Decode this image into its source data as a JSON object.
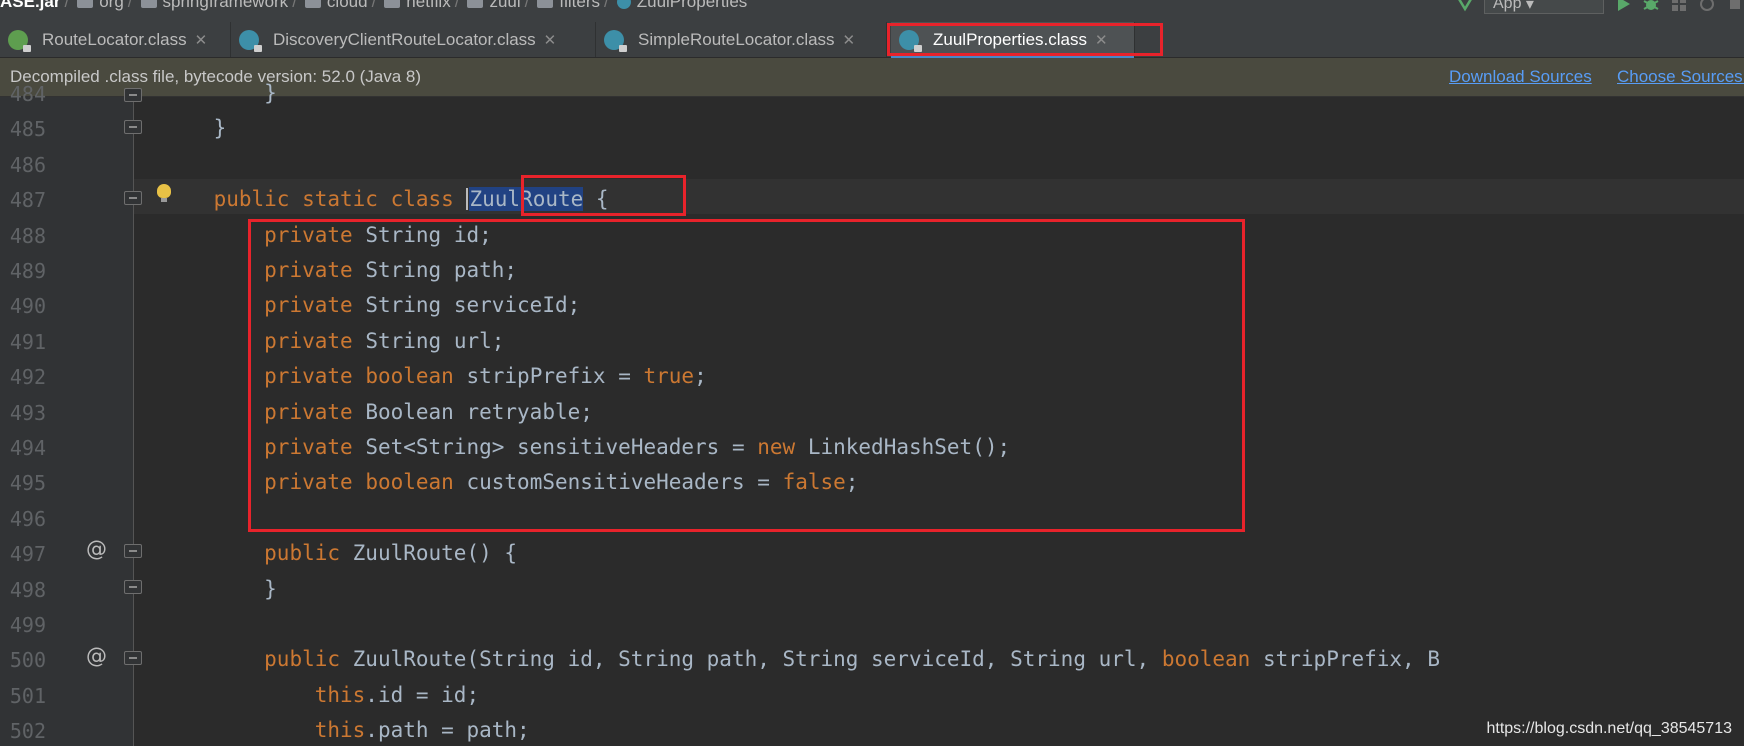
{
  "breadcrumb": [
    "ASE.jar",
    "org",
    "springframework",
    "cloud",
    "netflix",
    "zuul",
    "filters",
    "ZuulProperties"
  ],
  "toolbar": {
    "run_config": "App"
  },
  "tabs": [
    {
      "label": "RouteLocator.class",
      "icon": "interface-icon"
    },
    {
      "label": "DiscoveryClientRouteLocator.class",
      "icon": "class-icon"
    },
    {
      "label": "SimpleRouteLocator.class",
      "icon": "class-icon"
    },
    {
      "label": "ZuulProperties.class",
      "icon": "class-icon",
      "active": true
    }
  ],
  "infobar": {
    "message": "Decompiled .class file, bytecode version: 52.0 (Java 8)",
    "download_sources": "Download Sources",
    "choose_sources": "Choose Sources..."
  },
  "editor": {
    "lines": [
      {
        "n": "484",
        "text": "        }"
      },
      {
        "n": "485",
        "text": "    }"
      },
      {
        "n": "486",
        "text": ""
      },
      {
        "n": "487",
        "text": "    public static class ZuulRoute {"
      },
      {
        "n": "488",
        "text": "        private String id;"
      },
      {
        "n": "489",
        "text": "        private String path;"
      },
      {
        "n": "490",
        "text": "        private String serviceId;"
      },
      {
        "n": "491",
        "text": "        private String url;"
      },
      {
        "n": "492",
        "text": "        private boolean stripPrefix = true;"
      },
      {
        "n": "493",
        "text": "        private Boolean retryable;"
      },
      {
        "n": "494",
        "text": "        private Set<String> sensitiveHeaders = new LinkedHashSet();"
      },
      {
        "n": "495",
        "text": "        private boolean customSensitiveHeaders = false;"
      },
      {
        "n": "496",
        "text": ""
      },
      {
        "n": "497",
        "text": "        public ZuulRoute() {"
      },
      {
        "n": "498",
        "text": "        }"
      },
      {
        "n": "499",
        "text": ""
      },
      {
        "n": "500",
        "text": "        public ZuulRoute(String id, String path, String serviceId, String url, boolean stripPrefix, B"
      },
      {
        "n": "501",
        "text": "            this.id = id;"
      },
      {
        "n": "502",
        "text": "            this.path = path;"
      }
    ],
    "selected_text": "ZuulRoute"
  },
  "watermark": "https://blog.csdn.net/qq_38545713",
  "colors": {
    "keyword": "#cc7832",
    "text": "#a9b7c6",
    "line_number": "#606366",
    "selection": "#214283",
    "annotation_box": "#e8232b",
    "link": "#589df6"
  }
}
